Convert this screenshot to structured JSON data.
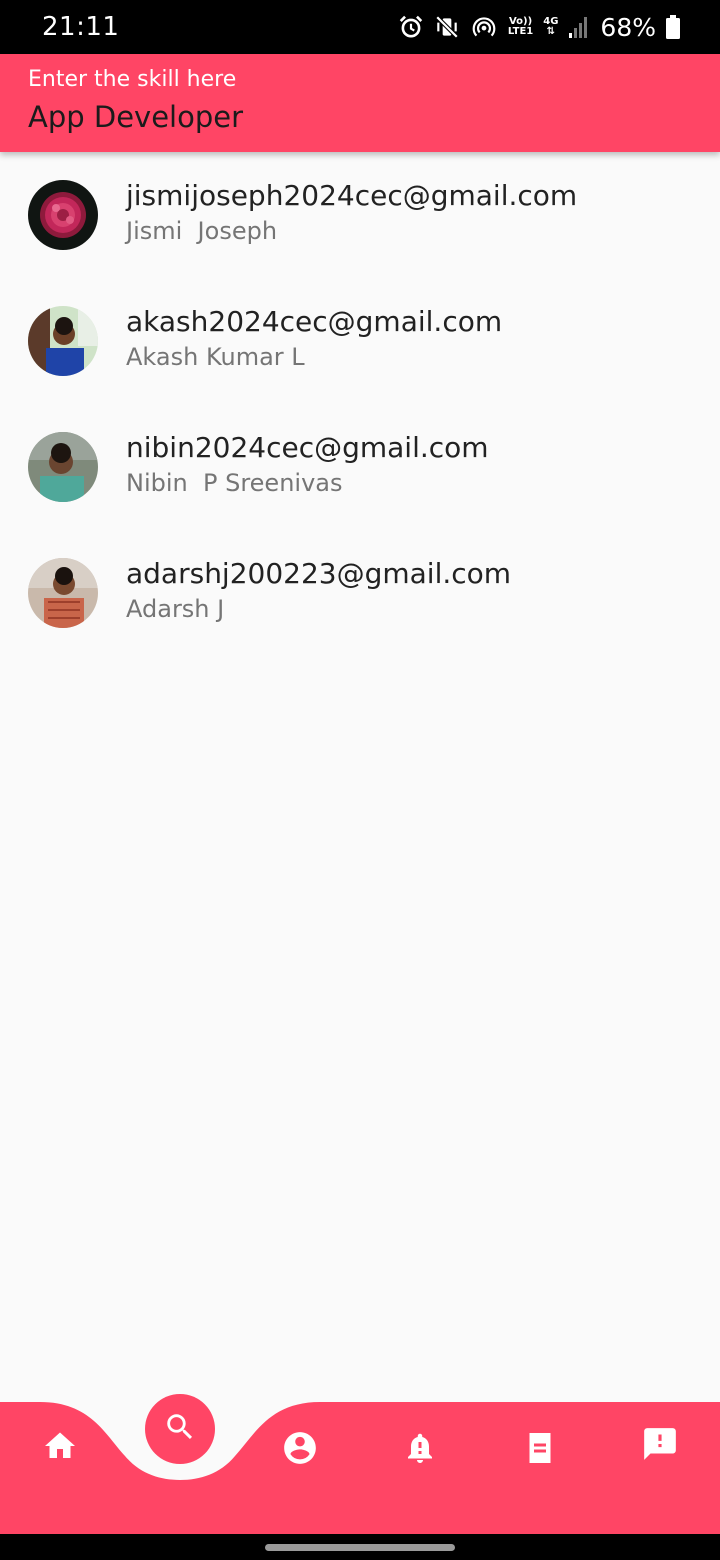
{
  "status_bar": {
    "time": "21:11",
    "network_top": "Vo))",
    "network_bottom": "LTE1",
    "network_type": "4G",
    "battery_percent": "68%"
  },
  "search": {
    "label": "Enter the skill here",
    "value": "App Developer"
  },
  "results": [
    {
      "email": "jismijoseph2024cec@gmail.com",
      "name": "Jismi  Joseph"
    },
    {
      "email": "akash2024cec@gmail.com",
      "name": "Akash Kumar L"
    },
    {
      "email": "nibin2024cec@gmail.com",
      "name": "Nibin  P Sreenivas"
    },
    {
      "email": "adarshj200223@gmail.com",
      "name": "Adarsh J"
    }
  ],
  "nav": {
    "items": [
      "home-icon",
      "search-icon",
      "account-icon",
      "bell-alert-icon",
      "document-icon",
      "feedback-icon"
    ],
    "active": "search-icon"
  },
  "colors": {
    "accent": "#ff4565",
    "background": "#fafafa",
    "primary_text": "#222222",
    "secondary_text": "#757575"
  }
}
